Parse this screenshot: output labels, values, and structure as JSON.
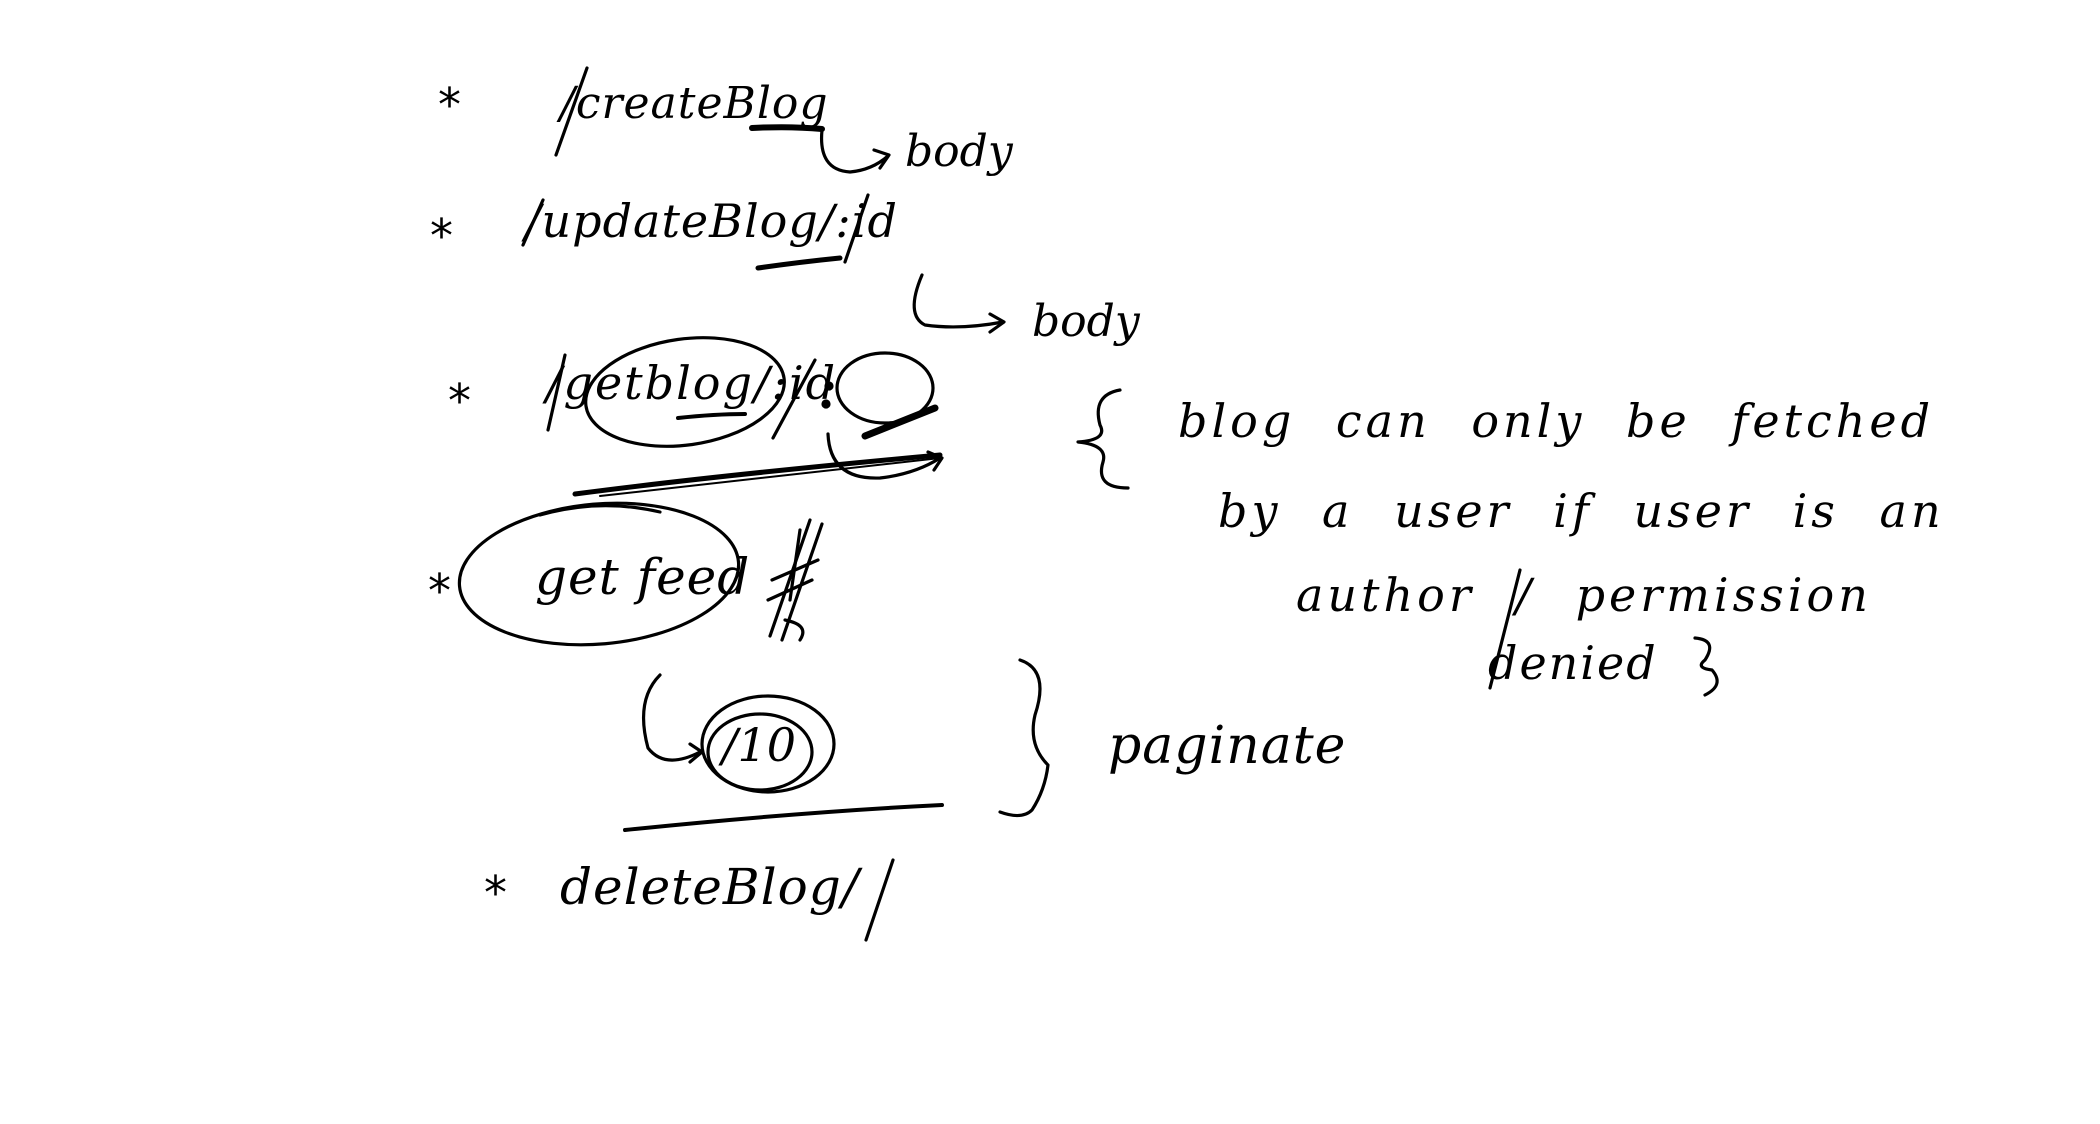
{
  "notes": {
    "bullet": "*",
    "create_route": "/createBlog",
    "create_arrow_label": "body",
    "update_route": "/updateBlog/:id",
    "update_arrow_label": "body",
    "get_route": "/getblog/:id",
    "get_note": "{ blog can only be fetched by a user if user is an author / permission denied }",
    "get_note_lines": [
      "blog can only be fetched",
      "by a user if user is an",
      "author / permission",
      "denied"
    ],
    "feed_label": "get feed",
    "page_size": "/10",
    "paginate_label": "paginate",
    "delete_route": "deleteBlog/"
  }
}
